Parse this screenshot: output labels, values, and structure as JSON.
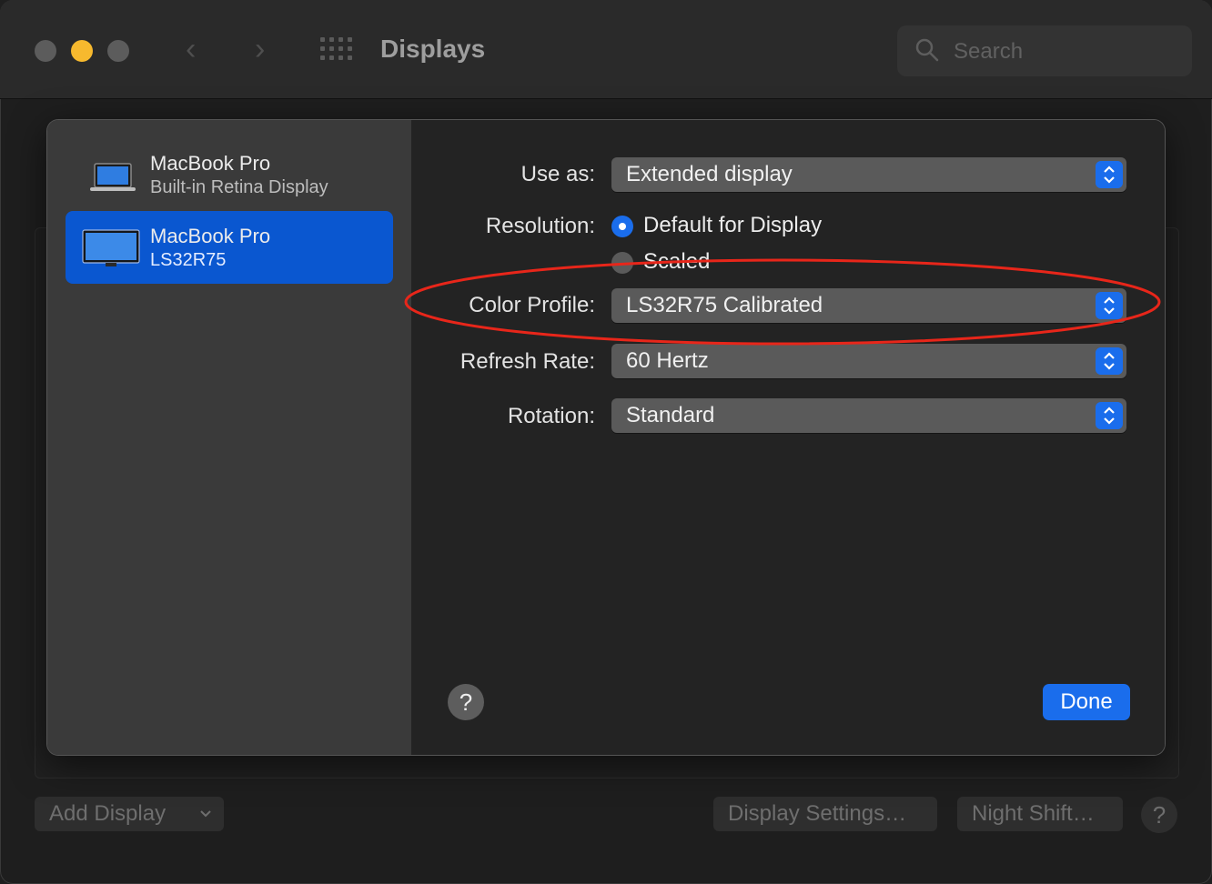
{
  "window": {
    "title": "Displays"
  },
  "search": {
    "placeholder": "Search"
  },
  "sidebar": {
    "items": [
      {
        "name": "MacBook Pro",
        "subtitle": "Built-in Retina Display",
        "selected": false
      },
      {
        "name": "MacBook Pro",
        "subtitle": "LS32R75",
        "selected": true
      }
    ]
  },
  "settings": {
    "use_as": {
      "label": "Use as:",
      "value": "Extended display"
    },
    "resolution": {
      "label": "Resolution:",
      "options": [
        "Default for Display",
        "Scaled"
      ],
      "selected": "Default for Display"
    },
    "color_profile": {
      "label": "Color Profile:",
      "value": "LS32R75 Calibrated"
    },
    "refresh_rate": {
      "label": "Refresh Rate:",
      "value": "60 Hertz"
    },
    "rotation": {
      "label": "Rotation:",
      "value": "Standard"
    }
  },
  "sheet_buttons": {
    "help": "?",
    "done": "Done"
  },
  "background_buttons": {
    "add_display": "Add Display",
    "display_settings": "Display Settings…",
    "night_shift": "Night Shift…",
    "help": "?"
  },
  "annotation": {
    "color": "#e8261a",
    "target": "Color Profile"
  },
  "colors": {
    "accent": "#1a6dec",
    "selection": "#0a57d0"
  }
}
